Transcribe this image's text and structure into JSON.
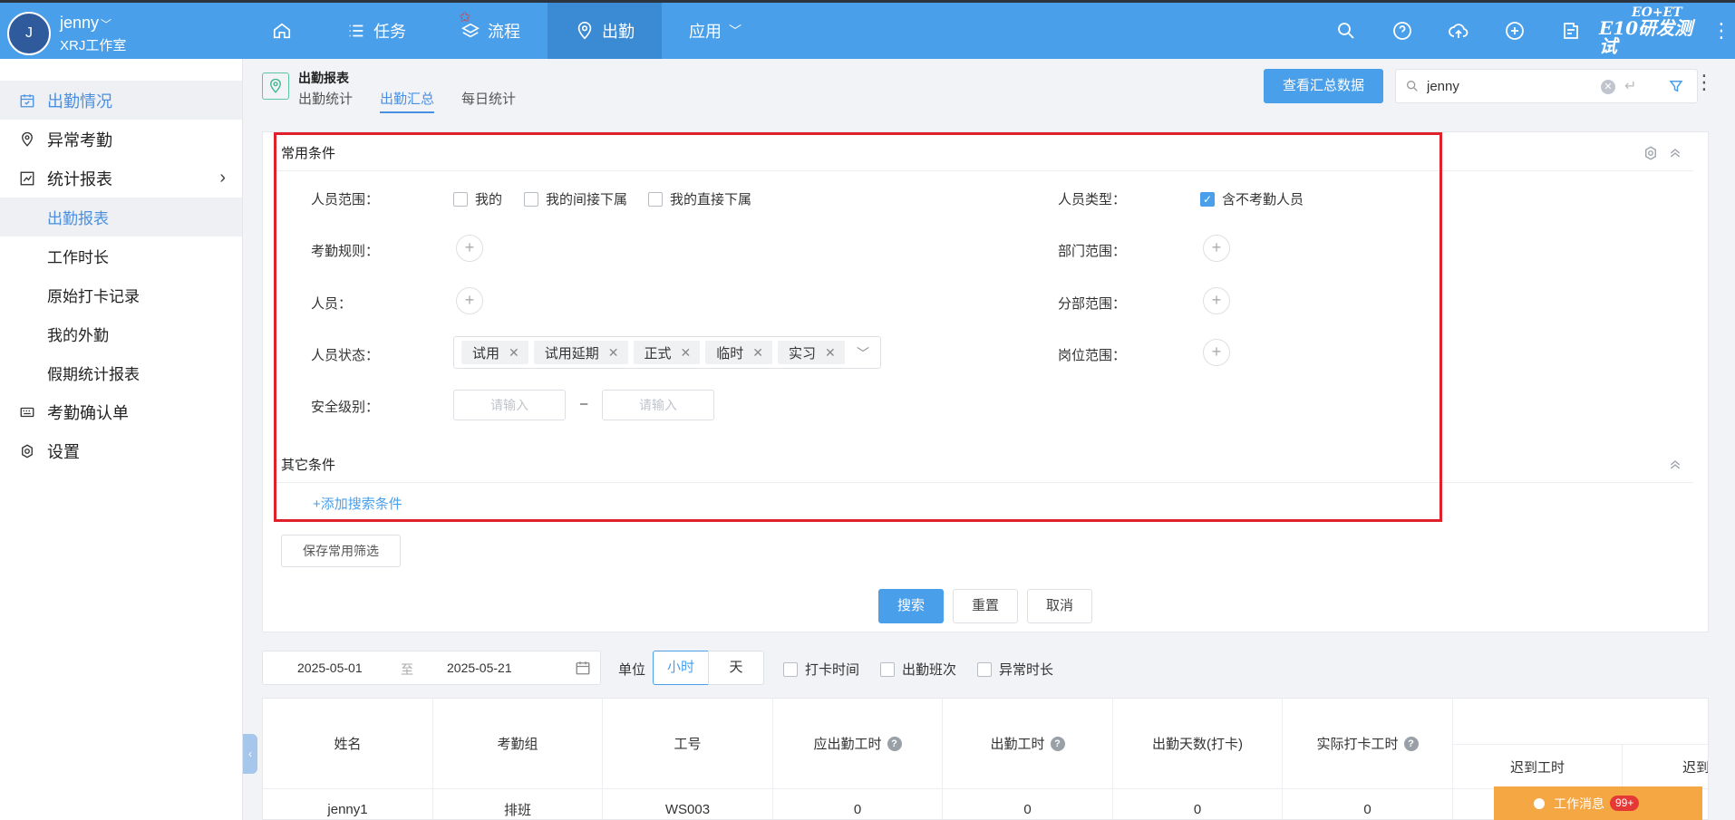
{
  "user": {
    "avatar_letter": "J",
    "name": "jenny",
    "org": "XRJ工作室"
  },
  "nav": {
    "items": [
      "任务",
      "流程",
      "出勤",
      "应用"
    ]
  },
  "brand": {
    "line1": "EO+ET",
    "line2": "E10研发测试"
  },
  "sidebar": {
    "items": [
      "出勤情况",
      "异常考勤",
      "统计报表",
      "出勤报表",
      "工作时长",
      "原始打卡记录",
      "我的外勤",
      "假期统计报表",
      "考勤确认单",
      "设置"
    ]
  },
  "page": {
    "title": "出勤报表",
    "tabs": [
      "出勤统计",
      "出勤汇总",
      "每日统计"
    ],
    "summary_button": "查看汇总数据",
    "search_value": "jenny"
  },
  "filter": {
    "common_title": "常用条件",
    "other_title": "其它条件",
    "labels": {
      "range": "人员范围：",
      "type": "人员类型：",
      "rule": "考勤规则：",
      "dept": "部门范围：",
      "person": "人员：",
      "branch": "分部范围：",
      "status": "人员状态：",
      "post": "岗位范围：",
      "security": "安全级别："
    },
    "range_options": [
      "我的",
      "我的间接下属",
      "我的直接下属"
    ],
    "type_option": "含不考勤人员",
    "status_tags": [
      "试用",
      "试用延期",
      "正式",
      "临时",
      "实习"
    ],
    "security_placeholder": "请输入",
    "dash": "–",
    "add_condition": "+添加搜索条件",
    "save_filter": "保存常用筛选"
  },
  "buttons": {
    "search": "搜索",
    "reset": "重置",
    "cancel": "取消"
  },
  "toolbar": {
    "date_from": "2025-05-01",
    "date_to_sep": "至",
    "date_to": "2025-05-21",
    "unit_label": "单位",
    "unit_hour": "小时",
    "unit_day": "天",
    "checks": [
      "打卡时间",
      "出勤班次",
      "异常时长"
    ]
  },
  "table": {
    "headers": [
      "姓名",
      "考勤组",
      "工号",
      "应出勤工时",
      "出勤工时",
      "出勤天数(打卡)",
      "实际打卡工时"
    ],
    "sub_headers": [
      "迟到工时",
      "迟到"
    ],
    "row": [
      "jenny1",
      "排班",
      "WS003",
      "0",
      "0",
      "0",
      "0"
    ]
  },
  "message": {
    "label": "工作消息",
    "count": "99+"
  }
}
